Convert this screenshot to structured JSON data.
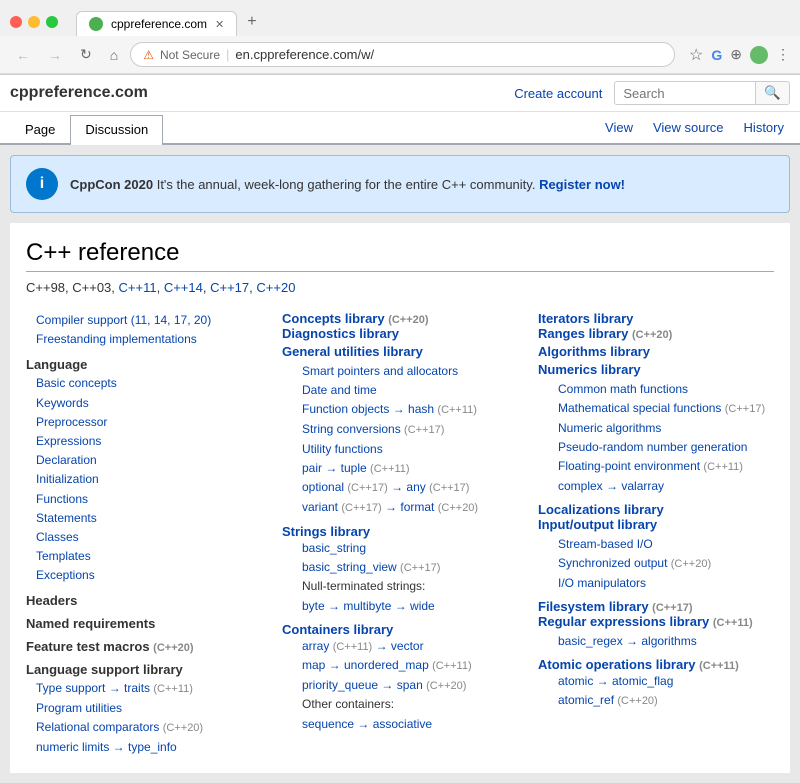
{
  "browser": {
    "tab_title": "cppreference.com",
    "tab_url": "en.cppreference.com/w/",
    "not_secure": "Not Secure",
    "new_tab": "+",
    "star_icon": "★",
    "nav_back": "←",
    "nav_forward": "→",
    "nav_refresh": "↻",
    "nav_home": "⌂"
  },
  "wiki": {
    "logo": "cppreference.com",
    "create_account": "Create account",
    "search_placeholder": "Search"
  },
  "tabs": {
    "page": "Page",
    "discussion": "Discussion",
    "view": "View",
    "view_source": "View source",
    "history": "History"
  },
  "banner": {
    "icon_text": "i",
    "title": "CppCon 2020",
    "text": "It's the annual, week-long gathering for the entire C++ community.",
    "link_text": "Register now!"
  },
  "main": {
    "title": "C++ reference",
    "subtitle_versions": "C++98, C++03, C++11, C++14, C++17, C++20"
  },
  "left_col": {
    "items": [
      {
        "text": "Compiler support (11, 14, 17, 20)",
        "link": true
      },
      {
        "text": "Freestanding implementations",
        "link": true
      },
      {
        "header": "Language"
      },
      {
        "text": "Basic concepts",
        "indent": 1,
        "link": true
      },
      {
        "text": "Keywords",
        "indent": 1,
        "link": true
      },
      {
        "text": "Preprocessor",
        "indent": 1,
        "link": true
      },
      {
        "text": "Expressions",
        "indent": 1,
        "link": true
      },
      {
        "text": "Declaration",
        "indent": 1,
        "link": true
      },
      {
        "text": "Initialization",
        "indent": 1,
        "link": true
      },
      {
        "text": "Functions",
        "indent": 1,
        "link": true
      },
      {
        "text": "Statements",
        "indent": 1,
        "link": true
      },
      {
        "text": "Classes",
        "indent": 1,
        "link": true
      },
      {
        "text": "Templates",
        "indent": 1,
        "link": true
      },
      {
        "text": "Exceptions",
        "indent": 1,
        "link": true
      },
      {
        "header": "Headers"
      },
      {
        "header": "Named requirements"
      },
      {
        "header_cpp": "Feature test macros (C++20)"
      },
      {
        "header": "Language support library"
      },
      {
        "text": "Type support → traits (C++11)",
        "indent": 1,
        "link": true
      },
      {
        "text": "Program utilities",
        "indent": 1,
        "link": true
      },
      {
        "text": "Relational comparators (C++20)",
        "indent": 1,
        "link": true
      },
      {
        "text": "numeric limits → type_info",
        "indent": 1,
        "link": true
      }
    ]
  },
  "middle_col": {
    "concepts": "Concepts library",
    "concepts_tag": "(C++20)",
    "diagnostics": "Diagnostics library",
    "general": "General utilities library",
    "general_items": [
      "Smart pointers and allocators",
      "Date and time",
      "Function objects → hash (C++11)",
      "String conversions (C++17)",
      "Utility functions",
      "pair → tuple (C++11)",
      "optional (C++17) → any (C++17)",
      "variant (C++17) → format (C++20)"
    ],
    "strings": "Strings library",
    "strings_items": [
      "basic_string",
      "basic_string_view (C++17)",
      "Null-terminated strings:",
      "byte → multibyte → wide"
    ],
    "containers": "Containers library",
    "containers_items": [
      "array (C++11) → vector",
      "map → unordered_map (C++11)",
      "priority_queue → span (C++20)",
      "Other containers:",
      "sequence → associative"
    ]
  },
  "right_col": {
    "iterators": "Iterators library",
    "ranges": "Ranges library",
    "ranges_tag": "(C++20)",
    "algorithms": "Algorithms library",
    "numerics": "Numerics library",
    "numerics_items": [
      "Common math functions",
      "Mathematical special functions (C++17)",
      "Numeric algorithms",
      "Pseudo-random number generation",
      "Floating-point environment (C++11)",
      "complex → valarray"
    ],
    "localizations": "Localizations library",
    "input_output": "Input/output library",
    "io_items": [
      "Stream-based I/O",
      "Synchronized output (C++20)",
      "I/O manipulators"
    ],
    "filesystem": "Filesystem library",
    "filesystem_tag": "(C++17)",
    "regex": "Regular expressions library",
    "regex_tag": "(C++11)",
    "regex_items": [
      "basic_regex → algorithms"
    ],
    "atomic": "Atomic operations library",
    "atomic_tag": "(C++11)",
    "atomic_items": [
      "atomic → atomic_flag",
      "atomic_ref (C++20)"
    ]
  }
}
